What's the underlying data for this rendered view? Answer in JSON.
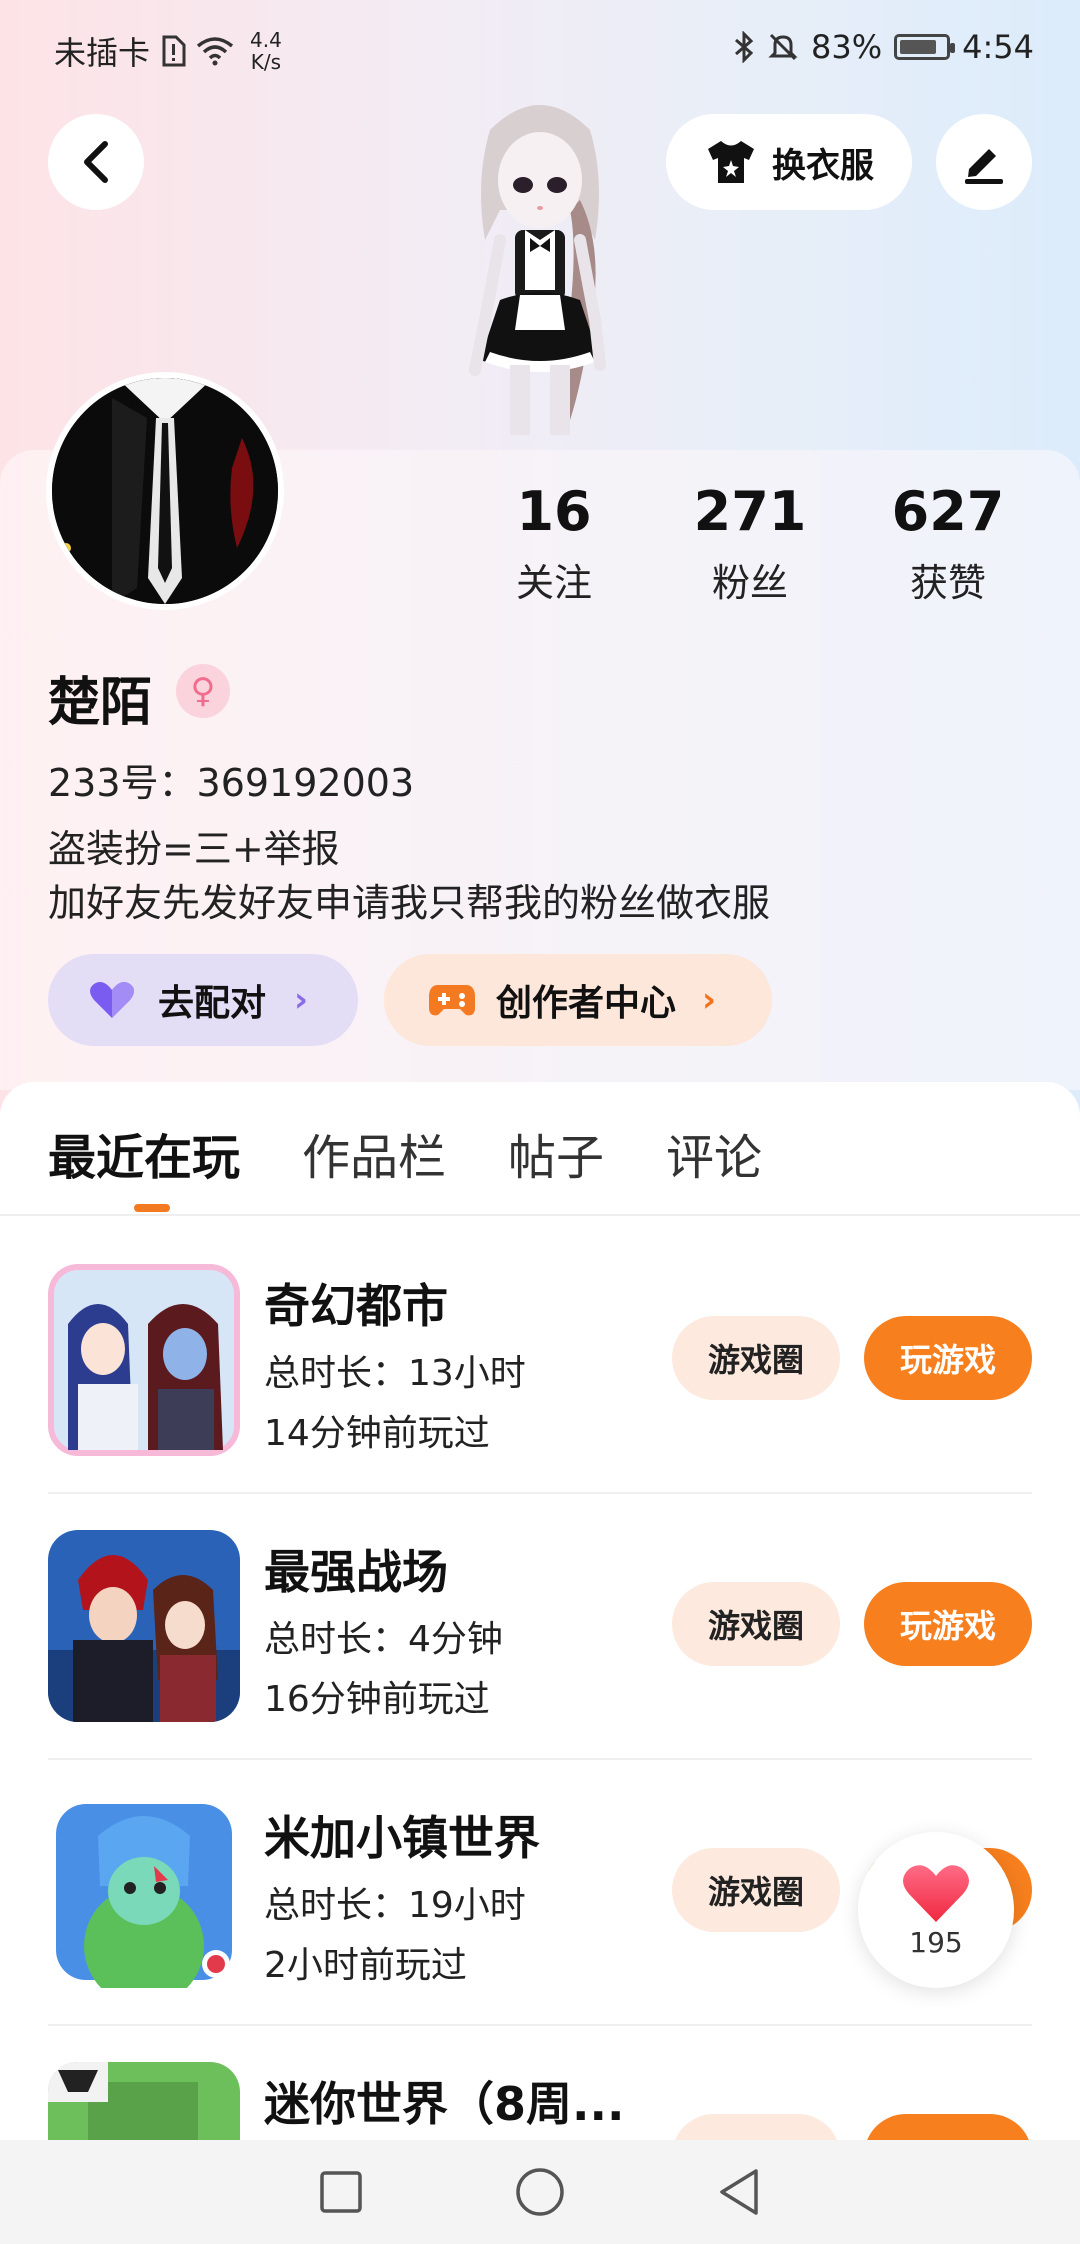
{
  "status_bar": {
    "carrier": "未插卡",
    "speed_value": "4.4",
    "speed_unit": "K/s",
    "battery": "83%",
    "time": "4:54",
    "battery_level": 0.83
  },
  "header": {
    "outfit_label": "换衣服"
  },
  "profile": {
    "stats": [
      {
        "value": "16",
        "label": "关注"
      },
      {
        "value": "271",
        "label": "粉丝"
      },
      {
        "value": "627",
        "label": "获赞"
      }
    ],
    "nickname": "楚陌",
    "uid": "233号：369192003",
    "bio_lines": [
      "盗装扮=三+举报",
      "加好友先发好友申请我只帮我的粉丝做衣服"
    ],
    "match_label": "去配对",
    "creator_label": "创作者中心"
  },
  "tabs": [
    {
      "label": "最近在玩",
      "active": true
    },
    {
      "label": "作品栏",
      "active": false
    },
    {
      "label": "帖子",
      "active": false
    },
    {
      "label": "评论",
      "active": false
    }
  ],
  "games": [
    {
      "name": "奇幻都市",
      "total": "总时长：13小时",
      "last": "14分钟前玩过",
      "circle_label": "游戏圈",
      "play_label": "玩游戏"
    },
    {
      "name": "最强战场",
      "total": "总时长：4分钟",
      "last": "16分钟前玩过",
      "circle_label": "游戏圈",
      "play_label": "玩游戏"
    },
    {
      "name": "米加小镇世界",
      "total": "总时长：19小时",
      "last": "2小时前玩过",
      "circle_label": "游戏圈",
      "play_label": "玩游戏"
    },
    {
      "name": "迷你世界（8周...",
      "total": "",
      "last": "",
      "circle_label": "",
      "play_label": ""
    }
  ],
  "like_float": {
    "count": "195"
  },
  "colors": {
    "accent": "#f77f1e",
    "match_bg": "#e4ddf6",
    "creator_bg": "#fde6da",
    "heart": "#f5405a"
  }
}
